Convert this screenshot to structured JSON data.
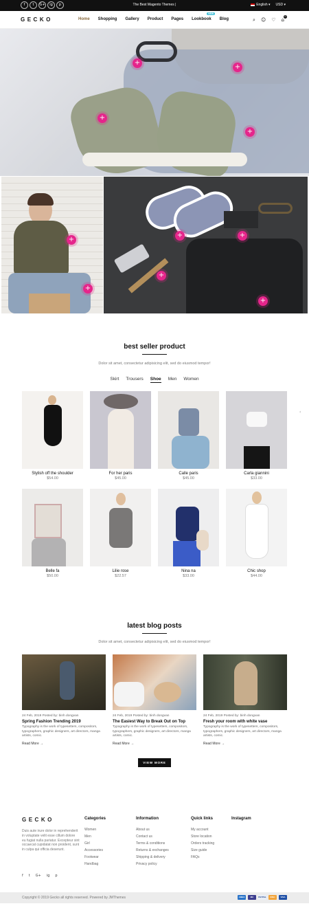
{
  "topbar": {
    "socials": [
      "f",
      "t",
      "G+",
      "ig",
      "p"
    ],
    "promo": "The Best Magento Themes",
    "promo_separator": "|",
    "language": "English",
    "currency": "USD"
  },
  "header": {
    "logo": "GECKO",
    "nav": [
      {
        "label": "Home"
      },
      {
        "label": "Shopping"
      },
      {
        "label": "Gallery"
      },
      {
        "label": "Product"
      },
      {
        "label": "Pages"
      },
      {
        "label": "Lookbook",
        "badge": "NEW"
      },
      {
        "label": "Blog"
      }
    ],
    "icons": [
      "search-icon",
      "user-icon",
      "heart-icon",
      "cart-icon"
    ],
    "cart_count": "0"
  },
  "best_seller": {
    "title": "best seller product",
    "subtitle": "Dolor sit amet, consectetur adipisicing elit, sed do eiusmod tempor!",
    "tabs": [
      "Skirt",
      "Trousers",
      "Shoe",
      "Men",
      "Women"
    ],
    "active_tab": "Shoe",
    "products": [
      {
        "name": "Stylish off the shoulder",
        "price": "$54.00"
      },
      {
        "name": "For her paris",
        "price": "$45.00"
      },
      {
        "name": "Calle paris",
        "price": "$45.00"
      },
      {
        "name": "Carla giannini",
        "price": "$33.00"
      },
      {
        "name": "Belle fa",
        "price": "$50.00"
      },
      {
        "name": "Lilie rose",
        "price": "$22.57"
      },
      {
        "name": "Nina na",
        "price": "$33.00"
      },
      {
        "name": "Chic shop",
        "price": "$44.00"
      }
    ]
  },
  "blog": {
    "title": "latest blog posts",
    "subtitle": "Dolor sit amet, consectetur adipisicing elit, sed do eiusmod tempor!",
    "posts": [
      {
        "meta": "24 Feb, 2019 Posted by: binh dongvan",
        "title": "Spring Fashion Trending 2019",
        "excerpt": "Typography is the work of typesetters, compositors, typographers, graphic designers, art directors, manga artists, comic.",
        "more": "Read More →"
      },
      {
        "meta": "24 Feb, 2019 Posted by: binh dongvan",
        "title": "The Easiest Way to Break Out on Top",
        "excerpt": "Typography is the work of typesetters, compositors, typographers, graphic designers, art directors, manga artists, comic.",
        "more": "Read More →"
      },
      {
        "meta": "24 Feb, 2019 Posted by: binh dongvan",
        "title": "Fresh your room with white vase",
        "excerpt": "Typography is the work of typesetters, compositors, typographers, graphic designers, art directors, manga artists, comic.",
        "more": "Read More →"
      }
    ],
    "view_more": "VIEW MORE"
  },
  "footer": {
    "logo": "GECKO",
    "about": "Duis aute irure dolor in reprehenderit in voluptate velit esse cillum dolore eu fugiat nulla pariatur. Excepteur sint occaecat cupidatat non proident, sunt in culpa qui officia deserunt.",
    "socials": [
      "f",
      "t",
      "G+",
      "ig",
      "p"
    ],
    "columns": [
      {
        "title": "Categories",
        "links": [
          "Women",
          "Men",
          "Girl",
          "Accessories",
          "Footwear",
          "Handbag"
        ]
      },
      {
        "title": "Information",
        "links": [
          "About us",
          "Contact us",
          "Terms & conditions",
          "Returns & exchanges",
          "Shipping & delivery",
          "Privacy policy"
        ]
      },
      {
        "title": "Quick links",
        "links": [
          "My account",
          "Store location",
          "Orders tracking",
          "Size guide",
          "FAQs"
        ]
      },
      {
        "title": "Instagram",
        "links": []
      }
    ],
    "copyright": "Copyright © 2019 Gecko all rights reserved. Powered by JMThemes",
    "payments": [
      "AMEX",
      "MC",
      "PAYPAL",
      "DISC",
      "VISA"
    ]
  },
  "colors": {
    "accent": "#e5258b",
    "dark": "#111111",
    "nav_active": "#8a6b3e",
    "badge": "#3fbfd8"
  }
}
